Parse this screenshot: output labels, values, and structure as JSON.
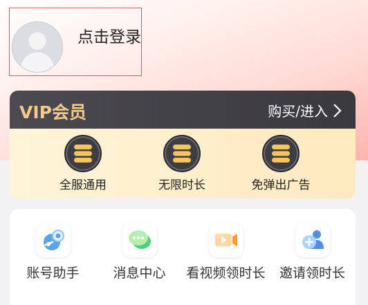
{
  "profile": {
    "login_label": "点击登录",
    "avatar_icon": "default-avatar-icon"
  },
  "vip": {
    "title": "VIP会员",
    "action_label": "购买/进入",
    "title_color": "#f2c98a",
    "benefits": [
      {
        "label": "全服通用",
        "icon": "server-stack-icon"
      },
      {
        "label": "无限时长",
        "icon": "server-stack-icon"
      },
      {
        "label": "免弹出广告",
        "icon": "server-stack-icon"
      }
    ]
  },
  "tools": [
    {
      "label": "账号助手",
      "icon": "steam-account-icon"
    },
    {
      "label": "消息中心",
      "icon": "chat-bubble-icon"
    },
    {
      "label": "看视频领时长",
      "icon": "video-play-icon"
    },
    {
      "label": "邀请领时长",
      "icon": "invite-user-icon"
    }
  ]
}
